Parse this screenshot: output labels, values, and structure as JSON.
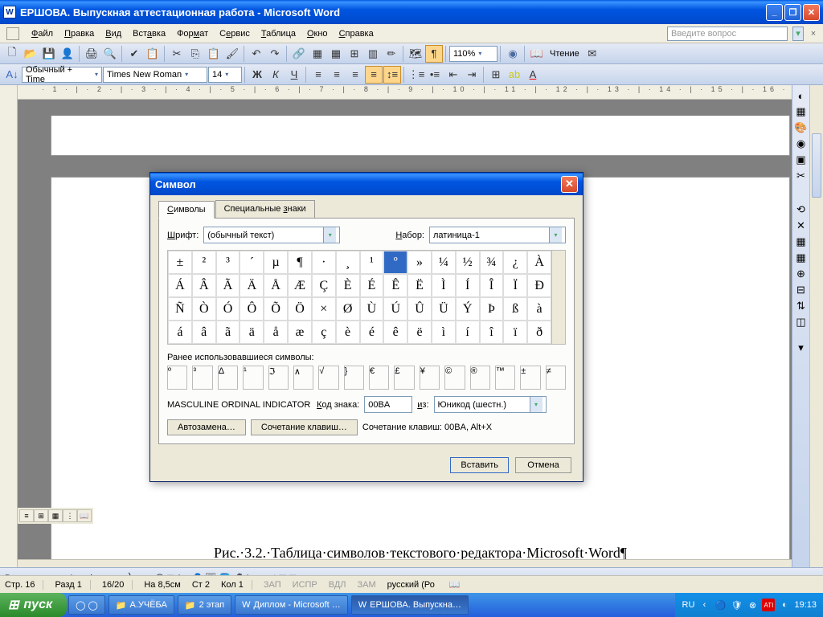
{
  "window": {
    "title": "ЕРШОВА. Выпускная аттестационная работа - Microsoft Word"
  },
  "menu": {
    "items": [
      "Файл",
      "Правка",
      "Вид",
      "Вставка",
      "Формат",
      "Сервис",
      "Таблица",
      "Окно",
      "Справка"
    ],
    "question_placeholder": "Введите вопрос"
  },
  "toolbar1": {
    "zoom": "110%",
    "reading": "Чтение"
  },
  "toolbar2": {
    "style": "Обычный + Time",
    "font": "Times New Roman",
    "size": "14"
  },
  "document": {
    "caption": "Рис.·3.2.·Таблица·символов·текстового·редактора·Microsoft·Word¶"
  },
  "dialog": {
    "title": "Символ",
    "tab_symbols": "Символы",
    "tab_special": "Специальные знаки",
    "font_label": "Шрифт:",
    "font_value": "(обычный текст)",
    "set_label": "Набор:",
    "set_value": "латиница-1",
    "grid_rows": [
      [
        "±",
        "²",
        "³",
        "´",
        "µ",
        "¶",
        "·",
        "¸",
        "¹",
        "º",
        "»",
        "¼",
        "½",
        "¾",
        "¿",
        "À"
      ],
      [
        "Á",
        "Â",
        "Ã",
        "Ä",
        "Å",
        "Æ",
        "Ç",
        "È",
        "É",
        "Ê",
        "Ë",
        "Ì",
        "Í",
        "Î",
        "Ï",
        "Ð"
      ],
      [
        "Ñ",
        "Ò",
        "Ó",
        "Ô",
        "Õ",
        "Ö",
        "×",
        "Ø",
        "Ù",
        "Ú",
        "Û",
        "Ü",
        "Ý",
        "Þ",
        "ß",
        "à"
      ],
      [
        "á",
        "â",
        "ã",
        "ä",
        "å",
        "æ",
        "ç",
        "è",
        "é",
        "ê",
        "ë",
        "ì",
        "í",
        "î",
        "ï",
        "ð"
      ]
    ],
    "selected": "º",
    "recent_label": "Ранее использовавшиеся символы:",
    "recent": [
      "º",
      "³",
      "Δ",
      "¹",
      "ℑ",
      "∧",
      "√",
      "}",
      "€",
      "£",
      "¥",
      "©",
      "®",
      "™",
      "±",
      "≠"
    ],
    "char_name": "MASCULINE ORDINAL INDICATOR",
    "code_label": "Код знака:",
    "code_value": "00BA",
    "from_label": "из:",
    "from_value": "Юникод (шестн.)",
    "autocorrect": "Автозамена…",
    "shortcut": "Сочетание клавиш…",
    "shortcut_info": "Сочетание клавиш: 00BA, Alt+X",
    "insert": "Вставить",
    "cancel": "Отмена"
  },
  "drawbar": {
    "label": "Рисование",
    "autoshapes": "Автофигуры"
  },
  "status": {
    "page": "Стр. 16",
    "section": "Разд 1",
    "pages": "16/20",
    "at": "На 8,5см",
    "line": "Ст 2",
    "col": "Кол 1",
    "m1": "ЗАП",
    "m2": "ИСПР",
    "m3": "ВДЛ",
    "m4": "ЗАМ",
    "lang": "русский (Ро"
  },
  "taskbar": {
    "start": "пуск",
    "buttons": [
      "А.УЧЁБА",
      "2 этап",
      "Диплом - Microsoft …",
      "ЕРШОВА. Выпускна…"
    ],
    "lang": "RU",
    "time": "19:13"
  }
}
